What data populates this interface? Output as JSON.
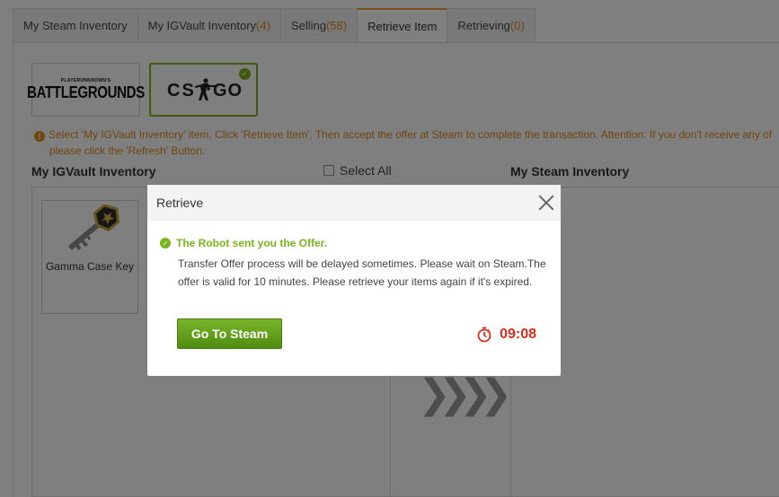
{
  "tabs": [
    {
      "label": "My Steam Inventory",
      "count": ""
    },
    {
      "label": "My IGVault Inventory",
      "count": "(4)"
    },
    {
      "label": "Selling",
      "count": "(58)"
    },
    {
      "label": "Retrieve Item",
      "count": ""
    },
    {
      "label": "Retrieving",
      "count": "(0)"
    }
  ],
  "active_tab": "Retrieve Item",
  "games": {
    "pubg": {
      "small_text": "PLAYERUNKNOWN'S",
      "name": "BATTLEGROUNDS"
    },
    "csgo": {
      "name": "CS GO",
      "selected": true
    }
  },
  "notice": {
    "line1": "Select 'My IGVault Inventory' item, Click 'Retrieve Item', Then accept the offer at Steam to complete the transaction. Attention: If you don't receive any of",
    "line2": "please click the 'Refresh' Button."
  },
  "left_title": "My IGVault Inventory",
  "select_all": "Select All",
  "right_title": "My Steam Inventory",
  "items": [
    {
      "name": "Gamma Case Key"
    }
  ],
  "modal": {
    "title": "Retrieve",
    "success": "The Robot sent you the Offer.",
    "description": "Transfer Offer process will be delayed sometimes. Please wait on Steam.The offer is valid for 10 minutes. Please retrieve your items again if it's expired.",
    "button": "Go To Steam",
    "timer": "09:08"
  },
  "colors": {
    "accent_orange": "#e08a1e",
    "success_green": "#7ab51d",
    "timer_red": "#e02a1a"
  }
}
